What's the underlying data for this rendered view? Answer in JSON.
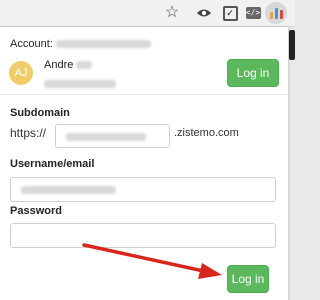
{
  "toolbar": {
    "icons": [
      "star-icon",
      "eye-icon",
      "checkbox-icon",
      "code-icon",
      "extension-icon"
    ]
  },
  "popup": {
    "account_label": "Account:",
    "user": {
      "avatar_initials": "AJ",
      "name": "Andre",
      "avatar_color": "#f1cd6a"
    },
    "top_button_label": "Log in",
    "subdomain": {
      "label": "Subdomain",
      "prefix": "https://",
      "suffix": ".zistemo.com"
    },
    "username": {
      "label": "Username/email"
    },
    "password": {
      "label": "Password"
    },
    "bottom_button_label": "Log in"
  },
  "colors": {
    "button": "#5cb85c",
    "arrow": "#d9261c"
  }
}
